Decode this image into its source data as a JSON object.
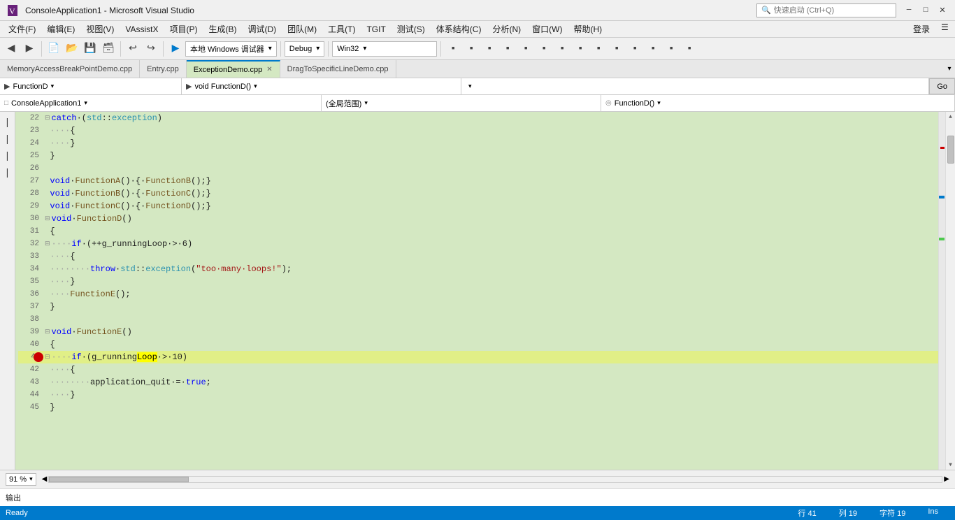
{
  "titlebar": {
    "title": "ConsoleApplication1 - Microsoft Visual Studio",
    "search_placeholder": "快速启动 (Ctrl+Q)",
    "min_label": "─",
    "max_label": "□",
    "close_label": "✕"
  },
  "menubar": {
    "items": [
      "文件(F)",
      "编辑(E)",
      "视图(V)",
      "VAssistX",
      "项目(P)",
      "生成(B)",
      "调试(D)",
      "团队(M)",
      "工具(T)",
      "TGIT",
      "测试(S)",
      "体系结构(C)",
      "分析(N)",
      "窗口(W)",
      "帮助(H)"
    ],
    "login": "登录"
  },
  "toolbar": {
    "debug_target": "本地 Windows 调试器",
    "config": "Debug",
    "platform": "Win32",
    "go_label": "▶"
  },
  "tabs": [
    {
      "label": "MemoryAccessBreakPointDemo.cpp",
      "active": false,
      "closeable": false
    },
    {
      "label": "Entry.cpp",
      "active": false,
      "closeable": false
    },
    {
      "label": "ExceptionDemo.cpp",
      "active": true,
      "closeable": true
    },
    {
      "label": "DragToSpecificLineDemo.cpp",
      "active": false,
      "closeable": false
    }
  ],
  "navbar": {
    "left_icon": "▶",
    "left_text": "FunctionD",
    "mid_icon": "▶",
    "mid_text": "void FunctionD()",
    "go_label": "Go"
  },
  "scopebar": {
    "left_icon": "□",
    "left_text": "ConsoleApplication1",
    "mid_text": "(全局范围)",
    "right_icon": "◎",
    "right_text": "FunctionD()"
  },
  "code": {
    "lines": [
      {
        "num": "22",
        "indent": 0,
        "content": "catch·(std::exception)",
        "has_expand": false,
        "is_catch": true
      },
      {
        "num": "23",
        "indent": 0,
        "content": "····{",
        "has_expand": false
      },
      {
        "num": "24",
        "indent": 0,
        "content": "····}",
        "has_expand": false
      },
      {
        "num": "25",
        "indent": 0,
        "content": "}",
        "has_expand": false
      },
      {
        "num": "26",
        "indent": 0,
        "content": "",
        "has_expand": false
      },
      {
        "num": "27",
        "indent": 0,
        "content": "void·FunctionA()·{·FunctionB();}",
        "has_expand": false
      },
      {
        "num": "28",
        "indent": 0,
        "content": "void·FunctionB()·{·FunctionC();}",
        "has_expand": false
      },
      {
        "num": "29",
        "indent": 0,
        "content": "void·FunctionC()·{·FunctionD();}",
        "has_expand": false
      },
      {
        "num": "30",
        "indent": 0,
        "content": "void·FunctionD()",
        "has_expand": true,
        "expand_char": "⊟"
      },
      {
        "num": "31",
        "indent": 0,
        "content": "{",
        "has_expand": false
      },
      {
        "num": "32",
        "indent": 0,
        "content": "····if·(++g_runningLoop·>·6)",
        "has_expand": true,
        "expand_char": "⊟"
      },
      {
        "num": "33",
        "indent": 0,
        "content": "····{",
        "has_expand": false
      },
      {
        "num": "34",
        "indent": 0,
        "content": "········throw·std::exception(\"too·many·loops!\");",
        "has_expand": false
      },
      {
        "num": "35",
        "indent": 0,
        "content": "····}",
        "has_expand": false
      },
      {
        "num": "36",
        "indent": 0,
        "content": "····FunctionE();",
        "has_expand": false
      },
      {
        "num": "37",
        "indent": 0,
        "content": "}",
        "has_expand": false
      },
      {
        "num": "38",
        "indent": 0,
        "content": "",
        "has_expand": false
      },
      {
        "num": "39",
        "indent": 0,
        "content": "void·FunctionE()",
        "has_expand": true,
        "expand_char": "⊟"
      },
      {
        "num": "40",
        "indent": 0,
        "content": "{",
        "has_expand": false
      },
      {
        "num": "41",
        "indent": 0,
        "content": "····if·(g_runningLoop·>·10)",
        "has_expand": true,
        "expand_char": "⊟",
        "breakpoint": true,
        "current": true,
        "highlight_word": "Loop"
      },
      {
        "num": "42",
        "indent": 0,
        "content": "····{",
        "has_expand": false
      },
      {
        "num": "43",
        "indent": 0,
        "content": "········application_quit·=·true;",
        "has_expand": false
      },
      {
        "num": "44",
        "indent": 0,
        "content": "····}",
        "has_expand": false
      },
      {
        "num": "45",
        "indent": 0,
        "content": "}",
        "has_expand": false
      }
    ]
  },
  "bottombar": {
    "zoom": "91 %"
  },
  "statusbar": {
    "ready": "Ready",
    "row": "行 41",
    "col": "列 19",
    "char": "字符 19",
    "ins": "Ins"
  },
  "outputpanel": {
    "label": "输出"
  }
}
